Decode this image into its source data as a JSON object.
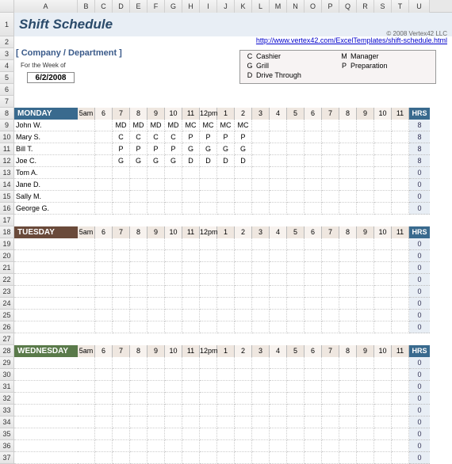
{
  "columns": [
    "A",
    "B",
    "C",
    "D",
    "E",
    "F",
    "G",
    "H",
    "I",
    "J",
    "K",
    "L",
    "M",
    "N",
    "O",
    "P",
    "Q",
    "R",
    "S",
    "T",
    "U"
  ],
  "rows": [
    1,
    2,
    3,
    4,
    5,
    6,
    7,
    8,
    9,
    10,
    11,
    12,
    13,
    14,
    15,
    16,
    17,
    18,
    19,
    20,
    21,
    22,
    23,
    24,
    25,
    26,
    27,
    28,
    29,
    30,
    31,
    32,
    33,
    34,
    35,
    36,
    37
  ],
  "title": "Shift Schedule",
  "copyright": "© 2008 Vertex42 LLC",
  "url": "http://www.vertex42.com/ExcelTemplates/shift-schedule.html",
  "company_label": "[ Company / Department ]",
  "week_label": "For the Week of",
  "week_date": "6/2/2008",
  "legend": [
    {
      "code": "C",
      "label": "Cashier"
    },
    {
      "code": "G",
      "label": "Grill"
    },
    {
      "code": "D",
      "label": "Drive Through"
    },
    {
      "code": "M",
      "label": "Manager"
    },
    {
      "code": "P",
      "label": "Preparation"
    }
  ],
  "time_headers": [
    "5am",
    "6",
    "7",
    "8",
    "9",
    "10",
    "11",
    "12pm",
    "1",
    "2",
    "3",
    "4",
    "5",
    "6",
    "7",
    "8",
    "9",
    "10",
    "11"
  ],
  "hrs_label": "HRS",
  "days": [
    {
      "name": "MONDAY",
      "class": "day-mon",
      "employees": [
        {
          "name": "John W.",
          "shifts": [
            "",
            "",
            "MD",
            "MD",
            "MD",
            "MD",
            "MC",
            "MC",
            "MC",
            "MC",
            "",
            "",
            "",
            "",
            "",
            "",
            "",
            "",
            ""
          ],
          "hrs": 8
        },
        {
          "name": "Mary S.",
          "shifts": [
            "",
            "",
            "C",
            "C",
            "C",
            "C",
            "P",
            "P",
            "P",
            "P",
            "",
            "",
            "",
            "",
            "",
            "",
            "",
            "",
            ""
          ],
          "hrs": 8
        },
        {
          "name": "Bill T.",
          "shifts": [
            "",
            "",
            "P",
            "P",
            "P",
            "P",
            "G",
            "G",
            "G",
            "G",
            "",
            "",
            "",
            "",
            "",
            "",
            "",
            "",
            ""
          ],
          "hrs": 8
        },
        {
          "name": "Joe C.",
          "shifts": [
            "",
            "",
            "G",
            "G",
            "G",
            "G",
            "D",
            "D",
            "D",
            "D",
            "",
            "",
            "",
            "",
            "",
            "",
            "",
            "",
            ""
          ],
          "hrs": 8
        },
        {
          "name": "Tom A.",
          "shifts": [
            "",
            "",
            "",
            "",
            "",
            "",
            "",
            "",
            "",
            "",
            "",
            "",
            "",
            "",
            "",
            "",
            "",
            "",
            ""
          ],
          "hrs": 0
        },
        {
          "name": "Jane D.",
          "shifts": [
            "",
            "",
            "",
            "",
            "",
            "",
            "",
            "",
            "",
            "",
            "",
            "",
            "",
            "",
            "",
            "",
            "",
            "",
            ""
          ],
          "hrs": 0
        },
        {
          "name": "Sally M.",
          "shifts": [
            "",
            "",
            "",
            "",
            "",
            "",
            "",
            "",
            "",
            "",
            "",
            "",
            "",
            "",
            "",
            "",
            "",
            "",
            ""
          ],
          "hrs": 0
        },
        {
          "name": "George G.",
          "shifts": [
            "",
            "",
            "",
            "",
            "",
            "",
            "",
            "",
            "",
            "",
            "",
            "",
            "",
            "",
            "",
            "",
            "",
            "",
            ""
          ],
          "hrs": 0
        }
      ]
    },
    {
      "name": "TUESDAY",
      "class": "day-tue",
      "employees": [
        {
          "name": "",
          "shifts": [
            "",
            "",
            "",
            "",
            "",
            "",
            "",
            "",
            "",
            "",
            "",
            "",
            "",
            "",
            "",
            "",
            "",
            "",
            ""
          ],
          "hrs": 0
        },
        {
          "name": "",
          "shifts": [
            "",
            "",
            "",
            "",
            "",
            "",
            "",
            "",
            "",
            "",
            "",
            "",
            "",
            "",
            "",
            "",
            "",
            "",
            ""
          ],
          "hrs": 0
        },
        {
          "name": "",
          "shifts": [
            "",
            "",
            "",
            "",
            "",
            "",
            "",
            "",
            "",
            "",
            "",
            "",
            "",
            "",
            "",
            "",
            "",
            "",
            ""
          ],
          "hrs": 0
        },
        {
          "name": "",
          "shifts": [
            "",
            "",
            "",
            "",
            "",
            "",
            "",
            "",
            "",
            "",
            "",
            "",
            "",
            "",
            "",
            "",
            "",
            "",
            ""
          ],
          "hrs": 0
        },
        {
          "name": "",
          "shifts": [
            "",
            "",
            "",
            "",
            "",
            "",
            "",
            "",
            "",
            "",
            "",
            "",
            "",
            "",
            "",
            "",
            "",
            "",
            ""
          ],
          "hrs": 0
        },
        {
          "name": "",
          "shifts": [
            "",
            "",
            "",
            "",
            "",
            "",
            "",
            "",
            "",
            "",
            "",
            "",
            "",
            "",
            "",
            "",
            "",
            "",
            ""
          ],
          "hrs": 0
        },
        {
          "name": "",
          "shifts": [
            "",
            "",
            "",
            "",
            "",
            "",
            "",
            "",
            "",
            "",
            "",
            "",
            "",
            "",
            "",
            "",
            "",
            "",
            ""
          ],
          "hrs": 0
        },
        {
          "name": "",
          "shifts": [
            "",
            "",
            "",
            "",
            "",
            "",
            "",
            "",
            "",
            "",
            "",
            "",
            "",
            "",
            "",
            "",
            "",
            "",
            ""
          ],
          "hrs": 0
        }
      ]
    },
    {
      "name": "WEDNESDAY",
      "class": "day-wed",
      "employees": [
        {
          "name": "",
          "shifts": [
            "",
            "",
            "",
            "",
            "",
            "",
            "",
            "",
            "",
            "",
            "",
            "",
            "",
            "",
            "",
            "",
            "",
            "",
            ""
          ],
          "hrs": 0
        },
        {
          "name": "",
          "shifts": [
            "",
            "",
            "",
            "",
            "",
            "",
            "",
            "",
            "",
            "",
            "",
            "",
            "",
            "",
            "",
            "",
            "",
            "",
            ""
          ],
          "hrs": 0
        },
        {
          "name": "",
          "shifts": [
            "",
            "",
            "",
            "",
            "",
            "",
            "",
            "",
            "",
            "",
            "",
            "",
            "",
            "",
            "",
            "",
            "",
            "",
            ""
          ],
          "hrs": 0
        },
        {
          "name": "",
          "shifts": [
            "",
            "",
            "",
            "",
            "",
            "",
            "",
            "",
            "",
            "",
            "",
            "",
            "",
            "",
            "",
            "",
            "",
            "",
            ""
          ],
          "hrs": 0
        },
        {
          "name": "",
          "shifts": [
            "",
            "",
            "",
            "",
            "",
            "",
            "",
            "",
            "",
            "",
            "",
            "",
            "",
            "",
            "",
            "",
            "",
            "",
            ""
          ],
          "hrs": 0
        },
        {
          "name": "",
          "shifts": [
            "",
            "",
            "",
            "",
            "",
            "",
            "",
            "",
            "",
            "",
            "",
            "",
            "",
            "",
            "",
            "",
            "",
            "",
            ""
          ],
          "hrs": 0
        },
        {
          "name": "",
          "shifts": [
            "",
            "",
            "",
            "",
            "",
            "",
            "",
            "",
            "",
            "",
            "",
            "",
            "",
            "",
            "",
            "",
            "",
            "",
            ""
          ],
          "hrs": 0
        },
        {
          "name": "",
          "shifts": [
            "",
            "",
            "",
            "",
            "",
            "",
            "",
            "",
            "",
            "",
            "",
            "",
            "",
            "",
            "",
            "",
            "",
            "",
            ""
          ],
          "hrs": 0
        },
        {
          "name": "",
          "shifts": [
            "",
            "",
            "",
            "",
            "",
            "",
            "",
            "",
            "",
            "",
            "",
            "",
            "",
            "",
            "",
            "",
            "",
            "",
            ""
          ],
          "hrs": 0
        }
      ]
    }
  ]
}
